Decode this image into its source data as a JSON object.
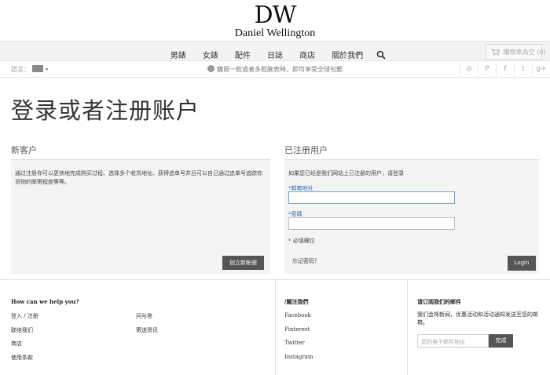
{
  "brand": {
    "mark": "DW",
    "name": "Daniel Wellington"
  },
  "nav": {
    "items": [
      "男錶",
      "女錶",
      "配件",
      "日誌",
      "商店",
      "關於我們"
    ],
    "search_icon": "search-icon"
  },
  "cart": {
    "label": "購物車為空",
    "count": "(0)",
    "icon": "cart-icon"
  },
  "subbar": {
    "language_label": "語言：",
    "promo": "購買一款或者多款腕表時，即可享受全球包郵",
    "social": [
      "instagram-icon",
      "pinterest-icon",
      "facebook-icon",
      "twitter-icon",
      "google-plus-icon"
    ],
    "social_glyphs": [
      "◎",
      "P",
      "f",
      "t",
      "g+"
    ]
  },
  "page_title": "登录或者注册账户",
  "new_customer": {
    "title": "新客户",
    "text": "通过注册你可以更快地完成购买过程、选择多个收货地址、获得追单号并且可以自己通过追单号追踪你货物的邮寄程度等等。",
    "button": "创立新帐號"
  },
  "registered": {
    "title": "已注册用户",
    "intro": "如果您已经是我们网站上已注册的用户，请登录",
    "email_label": "*邮箱地址",
    "email_value": "",
    "password_label": "*密碼",
    "password_value": "",
    "required_note": "* 必填欄位",
    "forgot": "忘记密码？",
    "button": "Login"
  },
  "footer": {
    "help_title": "How can we help you?",
    "help_col1": [
      "登入 / 注册",
      "联络我们",
      "商店",
      "使用条款"
    ],
    "help_col2": [
      "问与答",
      "寄送资讯"
    ],
    "follow_title": "/關注我們",
    "follow_links": [
      "Facebook",
      "Pinterest",
      "Twitter",
      "Instagram"
    ],
    "newsletter_title": "请订阅我们的邮件",
    "newsletter_text": "我们会将新闻，优惠活动和活动通知发送至您的邮箱。",
    "newsletter_placeholder": "您的电子邮件地址",
    "newsletter_button": "完成"
  }
}
